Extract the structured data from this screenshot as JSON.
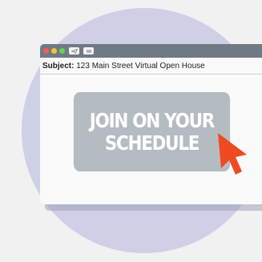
{
  "window": {
    "controls": {
      "close_color": "#f25d4f",
      "minimize_color": "#f5c431",
      "zoom_color": "#6ccf57"
    },
    "toolbar_icons": [
      "send-icon",
      "menu-icon"
    ]
  },
  "email": {
    "subject_label": "Subject:",
    "subject_value": "123 Main Street Virtual Open House",
    "cta_line1": "JOIN ON YOUR",
    "cta_line2": "SCHEDULE"
  },
  "colors": {
    "background_circle": "#cfcfe6",
    "titlebar": "#6f7a85",
    "button": "#b4bcc2",
    "cursor": "#f04a23"
  },
  "cursor_icon": "arrow-cursor-icon"
}
